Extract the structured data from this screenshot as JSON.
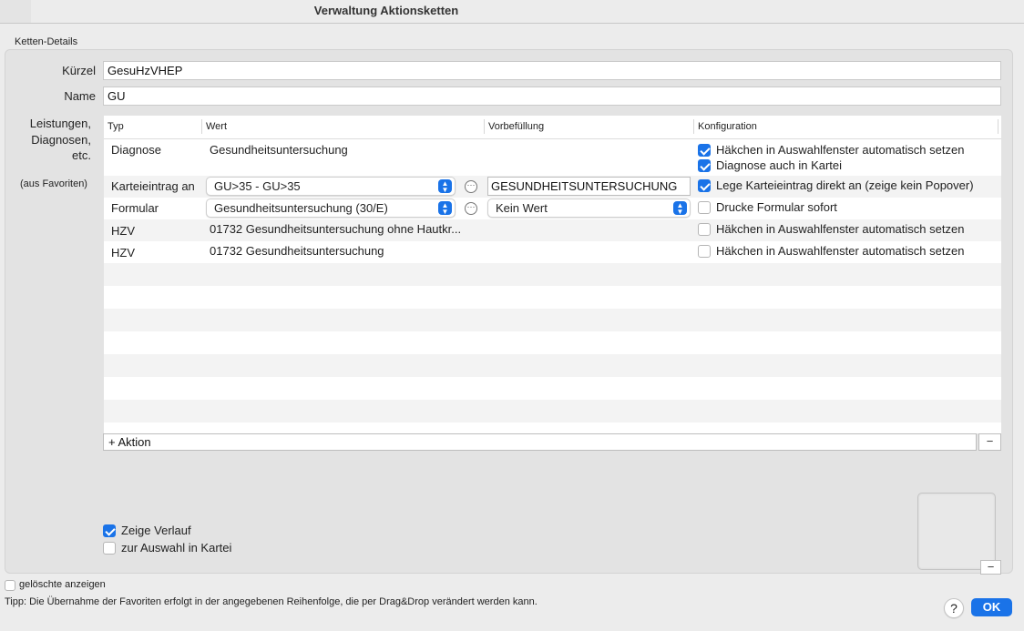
{
  "window": {
    "title": "Verwaltung Aktionsketten"
  },
  "details": {
    "section_label": "Ketten-Details",
    "kuerzel_label": "Kürzel",
    "kuerzel_value": "GesuHzVHEP",
    "name_label": "Name",
    "name_value": "GU",
    "leistungen_label_1": "Leistungen,",
    "leistungen_label_2": "Diagnosen,",
    "leistungen_label_3": "etc.",
    "aus_favoriten": "(aus Favoriten)"
  },
  "table": {
    "columns": [
      "Typ",
      "Wert",
      "Vorbefüllung",
      "Konfiguration"
    ],
    "rows": [
      {
        "typ": "Diagnose",
        "wert": "Gesundheitsuntersuchung",
        "config": [
          {
            "label": "Häkchen in Auswahlfenster automatisch setzen",
            "checked": true
          },
          {
            "label": "Diagnose auch in Kartei",
            "checked": true
          }
        ]
      },
      {
        "typ": "Karteieintrag an",
        "wert": "GU>35 - GU>35",
        "vorbefuellung": "GESUNDHEITSUNTERSUCHUNG",
        "config": [
          {
            "label": "Lege Karteieintrag direkt an (zeige kein Popover)",
            "checked": true
          }
        ]
      },
      {
        "typ": "Formular",
        "wert": "Gesundheitsuntersuchung (30/E)",
        "vorbefuellung": "Kein Wert",
        "config": [
          {
            "label": "Drucke Formular sofort",
            "checked": false
          }
        ]
      },
      {
        "typ": "HZV",
        "wert": "01732 Gesundheitsuntersuchung ohne Hautkr...",
        "config": [
          {
            "label": "Häkchen in Auswahlfenster automatisch setzen",
            "checked": false
          }
        ]
      },
      {
        "typ": "HZV",
        "wert": "01732 Gesundheitsuntersuchung",
        "config": [
          {
            "label": "Häkchen in Auswahlfenster automatisch setzen",
            "checked": false
          }
        ]
      }
    ],
    "add_label": "+ Aktion",
    "remove_label": "−"
  },
  "options": {
    "zeige_verlauf": {
      "label": "Zeige Verlauf",
      "checked": true
    },
    "zur_auswahl": {
      "label": "zur Auswahl in Kartei",
      "checked": false
    }
  },
  "thumbnail": {
    "remove_label": "−"
  },
  "footer": {
    "geloeschte": {
      "label": "gelöschte anzeigen",
      "checked": false
    },
    "tip": "Tipp: Die Übernahme der Favoriten erfolgt in der angegebenen Reihenfolge, die per Drag&Drop verändert werden kann.",
    "help_label": "?",
    "ok_label": "OK"
  },
  "colors": {
    "accent": "#1a73e8"
  },
  "icons": {
    "popup_arrows": "chevron-up-down-icon",
    "ellipsis": "ellipsis-circle-icon",
    "check": "checkmark-icon"
  }
}
